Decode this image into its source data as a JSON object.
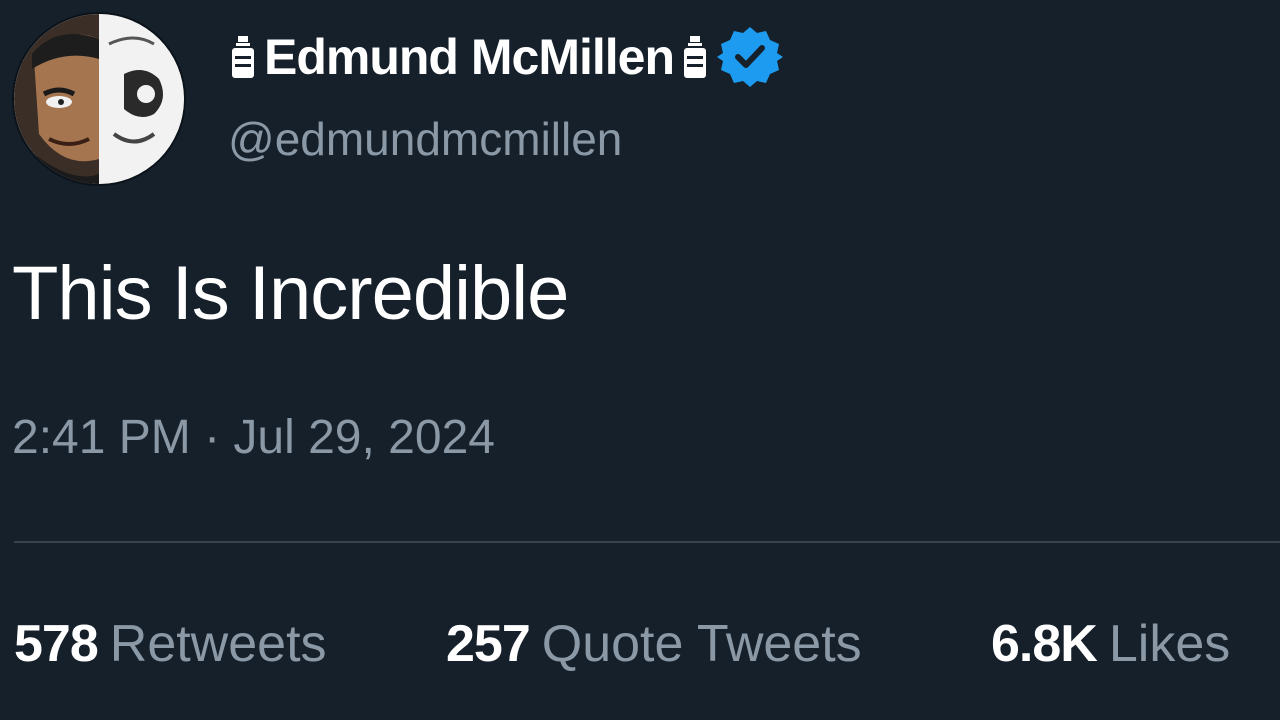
{
  "author": {
    "display_name": "Edmund McMillen",
    "handle": "@edmundmcmillen",
    "verified": true,
    "name_prefix_icon": "bottle-emoji-icon",
    "name_suffix_icon": "bottle-emoji-icon",
    "badge_icon": "verified-check-icon",
    "avatar_icon": "avatar-illustration"
  },
  "tweet": {
    "text": "This Is Incredible",
    "timestamp": "2:41 PM · Jul 29, 2024"
  },
  "stats": [
    {
      "count": "578",
      "label": "Retweets"
    },
    {
      "count": "257",
      "label": "Quote Tweets"
    },
    {
      "count": "6.8K",
      "label": "Likes"
    }
  ],
  "colors": {
    "background": "#15202b",
    "primary_text": "#ffffff",
    "secondary_text": "#8b98a5",
    "divider": "#38444d",
    "verified_blue": "#1d9bf0"
  }
}
